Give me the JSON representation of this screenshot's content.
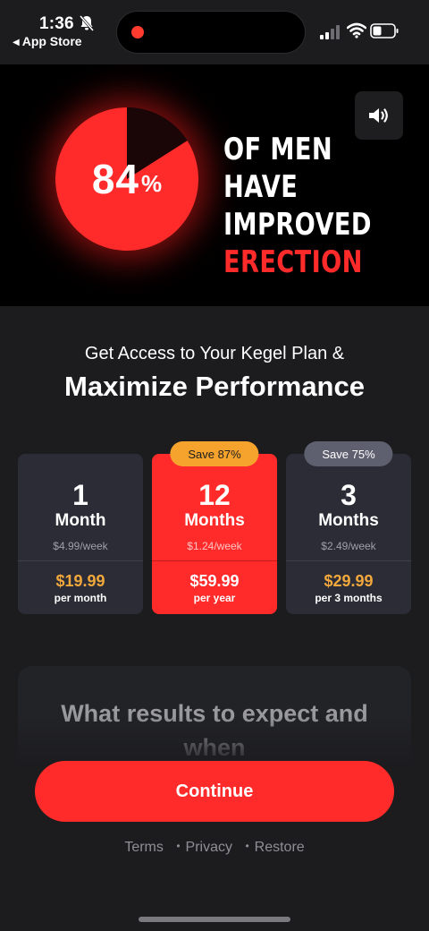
{
  "status_bar": {
    "time": "1:36",
    "back_label": "App Store"
  },
  "banner": {
    "percent_number": "84",
    "percent_sign": "%",
    "percent_value": 84,
    "headline_line1": "OF MEN HAVE",
    "headline_line2": "IMPROVED",
    "headline_line3": "ERECTION",
    "colors": {
      "accent_red": "#ff2a2a",
      "pie_remainder": "#1a0606"
    }
  },
  "heading": {
    "subtitle": "Get Access to Your Kegel Plan &",
    "title": "Maximize Performance"
  },
  "plans": [
    {
      "number": "1",
      "unit": "Month",
      "weekly": "$4.99/week",
      "price": "$19.99",
      "period": "per month",
      "badge": "",
      "selected": false
    },
    {
      "number": "12",
      "unit": "Months",
      "weekly": "$1.24/week",
      "price": "$59.99",
      "period": "per year",
      "badge": "Save 87%",
      "selected": true
    },
    {
      "number": "3",
      "unit": "Months",
      "weekly": "$2.49/week",
      "price": "$29.99",
      "period": "per 3 months",
      "badge": "Save 75%",
      "selected": false
    }
  ],
  "results": {
    "title_line1": "What results to expect and",
    "title_line2": "when"
  },
  "cta": {
    "label": "Continue"
  },
  "footer": {
    "terms": "Terms",
    "privacy": "Privacy",
    "restore": "Restore",
    "separator": "•"
  },
  "icons": {
    "bell": "bell-slash-icon",
    "sound": "speaker-icon",
    "signal": "cellular-signal-icon",
    "wifi": "wifi-icon",
    "battery": "battery-icon"
  }
}
